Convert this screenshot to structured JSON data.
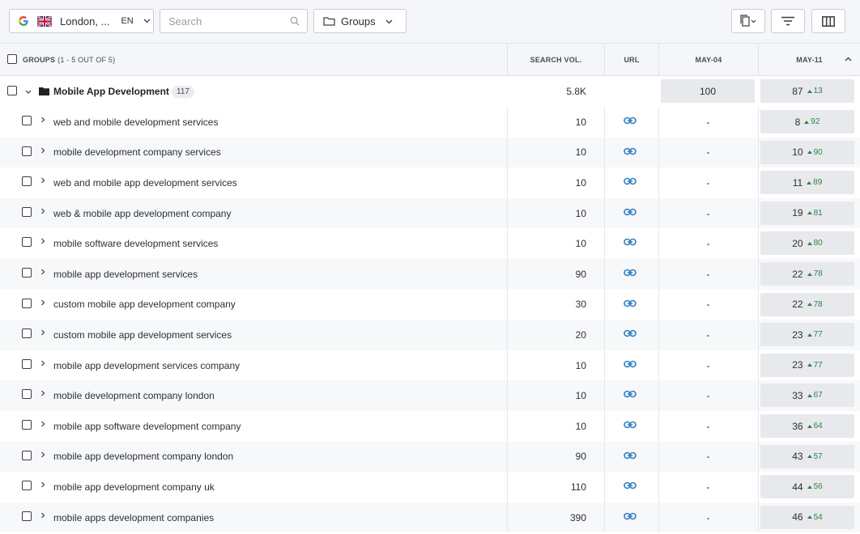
{
  "toolbar": {
    "location": "London, ...",
    "language": "EN",
    "search_placeholder": "Search",
    "groups_label": "Groups"
  },
  "table": {
    "header": {
      "groups_label": "GROUPS",
      "groups_count": "(1 - 5 OUT OF 5)",
      "search_vol": "SEARCH VOL.",
      "url": "URL",
      "date1": "MAY-04",
      "date2": "MAY-11"
    },
    "group": {
      "name": "Mobile App Development",
      "count": "117",
      "search_vol": "5.8K",
      "pos_may04": "100",
      "pos_may11": "87",
      "change_may11": "13"
    },
    "rows": [
      {
        "keyword": "web and mobile development services",
        "vol": "10",
        "may04": "-",
        "may11": "8",
        "change": "92"
      },
      {
        "keyword": "mobile development company services",
        "vol": "10",
        "may04": "-",
        "may11": "10",
        "change": "90"
      },
      {
        "keyword": "web and mobile app development services",
        "vol": "10",
        "may04": "-",
        "may11": "11",
        "change": "89"
      },
      {
        "keyword": "web & mobile app development company",
        "vol": "10",
        "may04": "-",
        "may11": "19",
        "change": "81"
      },
      {
        "keyword": "mobile software development services",
        "vol": "10",
        "may04": "-",
        "may11": "20",
        "change": "80"
      },
      {
        "keyword": "mobile app development services",
        "vol": "90",
        "may04": "-",
        "may11": "22",
        "change": "78"
      },
      {
        "keyword": "custom mobile app development company",
        "vol": "30",
        "may04": "-",
        "may11": "22",
        "change": "78"
      },
      {
        "keyword": "custom mobile app development services",
        "vol": "20",
        "may04": "-",
        "may11": "23",
        "change": "77"
      },
      {
        "keyword": "mobile app development services company",
        "vol": "10",
        "may04": "-",
        "may11": "23",
        "change": "77"
      },
      {
        "keyword": "mobile development company london",
        "vol": "10",
        "may04": "-",
        "may11": "33",
        "change": "67"
      },
      {
        "keyword": "mobile app software development company",
        "vol": "10",
        "may04": "-",
        "may11": "36",
        "change": "64"
      },
      {
        "keyword": "mobile app development company london",
        "vol": "90",
        "may04": "-",
        "may11": "43",
        "change": "57"
      },
      {
        "keyword": "mobile app development company uk",
        "vol": "110",
        "may04": "-",
        "may11": "44",
        "change": "56"
      },
      {
        "keyword": "mobile apps development companies",
        "vol": "390",
        "may04": "-",
        "may11": "46",
        "change": "54"
      }
    ]
  },
  "colors": {
    "accent_link": "#2f7fc1",
    "positive_change": "#2e8540",
    "header_bg": "#f5f6f9",
    "position_cell_bg": "#e8e9ed"
  }
}
